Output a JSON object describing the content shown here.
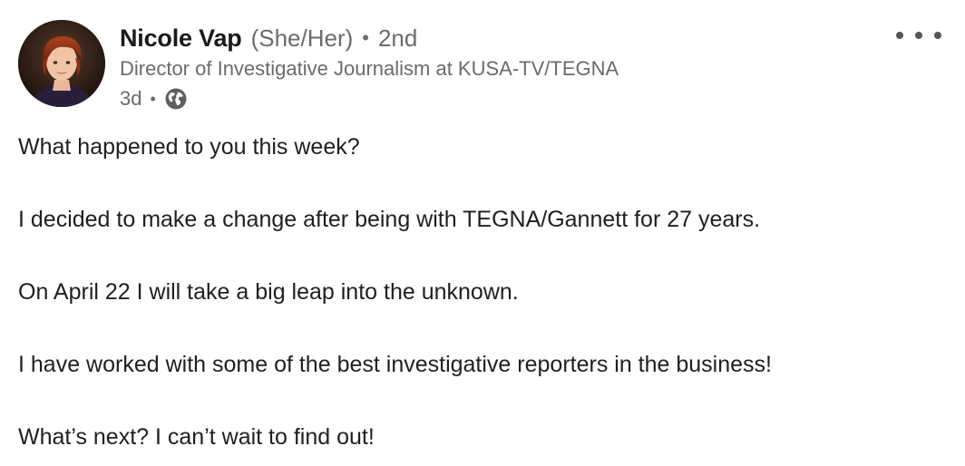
{
  "author": {
    "name": "Nicole Vap",
    "pronouns": "(She/Her)",
    "separator": "•",
    "degree": "2nd",
    "headline": "Director of Investigative Journalism at KUSA-TV/TEGNA",
    "time": "3d",
    "visibility_icon": "globe-icon"
  },
  "post": {
    "paragraphs": [
      "What happened to you this week?",
      "I decided to make a change after being with TEGNA/Gannett for 27 years.",
      "On April 22 I will take a big leap into the unknown.",
      "I have worked with some of the best investigative reporters in the business!",
      "What’s next? I can’t wait to find out!"
    ]
  },
  "controls": {
    "more_icon": "more-options-icon"
  },
  "colors": {
    "text_primary": "#1f1f1f",
    "text_secondary": "#6b6b6b",
    "background": "#ffffff"
  }
}
